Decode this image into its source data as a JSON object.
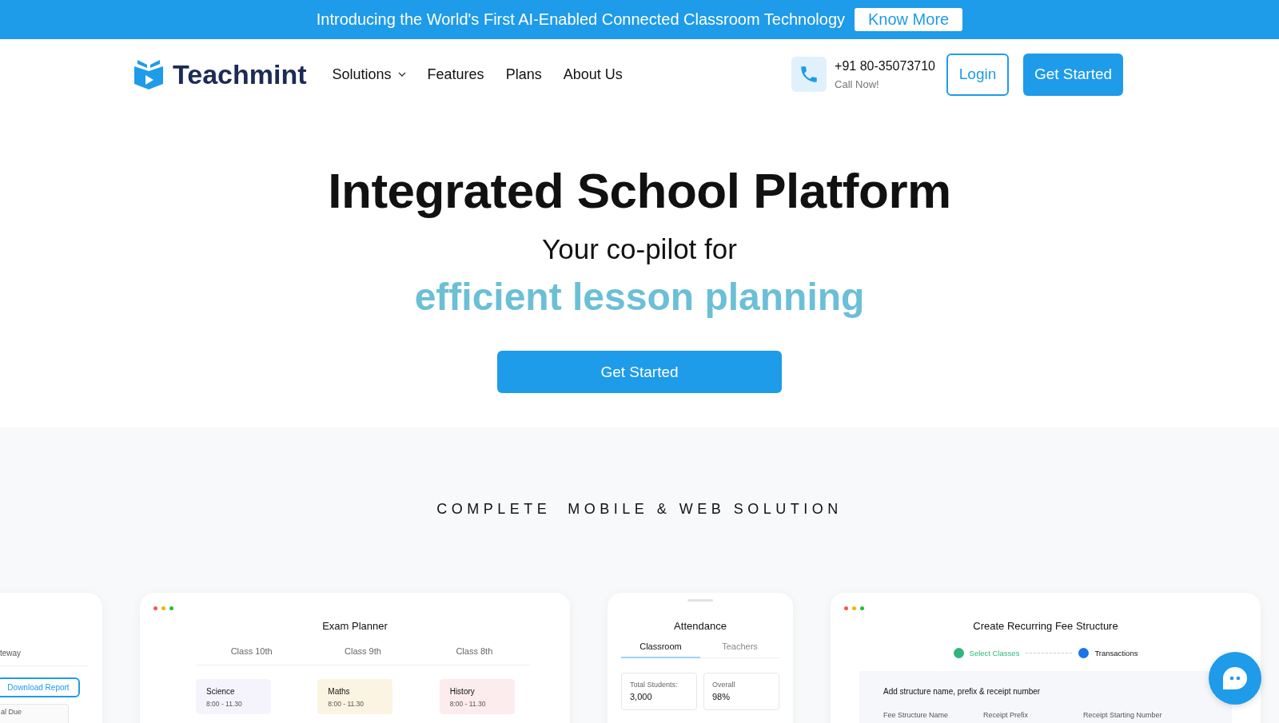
{
  "banner": {
    "text": "Introducing the World's First AI-Enabled Connected Classroom Technology",
    "button": "Know More"
  },
  "nav": {
    "logo": "Teachmint",
    "menu": [
      {
        "label": "Solutions",
        "has_dropdown": true
      },
      {
        "label": "Features",
        "has_dropdown": false
      },
      {
        "label": "Plans",
        "has_dropdown": false
      },
      {
        "label": "About Us",
        "has_dropdown": false
      }
    ],
    "phone": {
      "number": "+91 80-35073710",
      "caption": "Call Now!"
    },
    "login": "Login",
    "get_started": "Get Started"
  },
  "hero": {
    "title": "Integrated School Platform",
    "subtitle": "Your co-pilot for",
    "highlight": "efficient lesson planning",
    "cta": "Get Started"
  },
  "section_heading": "COMPLETE  MOBILE & WEB SOLUTION",
  "partial_card": {
    "label": "teway",
    "button": "Download Report",
    "field": "al Due"
  },
  "exam_planner": {
    "title": "Exam Planner",
    "columns": [
      {
        "label": "Class 10th",
        "subject": "Science",
        "time": "8:00 - 11.30",
        "color": "#f5f3fc"
      },
      {
        "label": "Class 9th",
        "subject": "Maths",
        "time": "8:00 - 11.30",
        "color": "#fbf4e2"
      },
      {
        "label": "Class 8th",
        "subject": "History",
        "time": "8:00 - 11.30",
        "color": "#fdecee"
      }
    ]
  },
  "attendance": {
    "title": "Attendance",
    "tabs": [
      {
        "label": "Classroom",
        "selected": true
      },
      {
        "label": "Teachers",
        "selected": false
      }
    ],
    "stats": [
      {
        "label": "Total Students:",
        "value": "3,000"
      },
      {
        "label": "Overall",
        "value": "98%"
      }
    ]
  },
  "fee_structure": {
    "title": "Create Recurring Fee Structure",
    "steps": [
      {
        "label": "Select Classes",
        "color": "#2eb67d"
      },
      {
        "label": "Transactions",
        "color": "#1a73e8"
      }
    ],
    "form_heading": "Add structure name, prefix & receipt number",
    "fields": [
      "Fee Structure Name",
      "Receipt Prefix",
      "Receipt Starting Number"
    ]
  }
}
